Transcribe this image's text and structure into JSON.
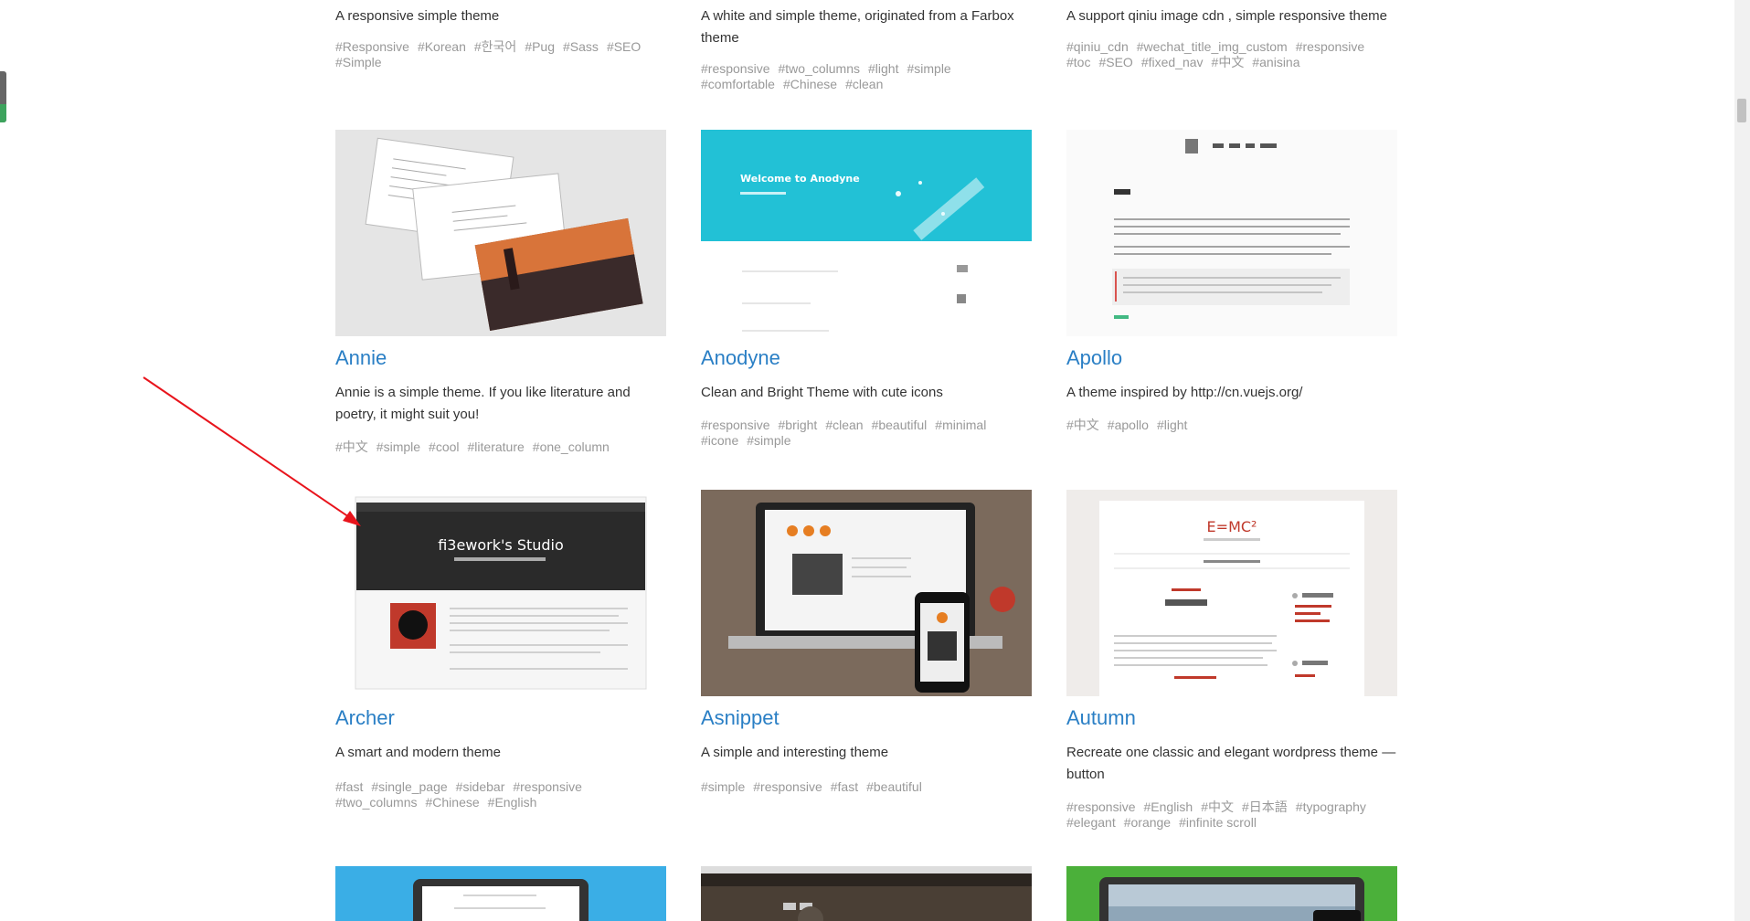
{
  "top_row": [
    {
      "desc": "A responsive simple theme",
      "tags": [
        "#Responsive",
        "#Korean",
        "#한국어",
        "#Pug",
        "#Sass",
        "#SEO",
        "#Simple"
      ]
    },
    {
      "desc": "A white and simple theme, originated from a Farbox theme",
      "tags": [
        "#responsive",
        "#two_columns",
        "#light",
        "#simple",
        "#comfortable",
        "#Chinese",
        "#clean"
      ]
    },
    {
      "desc": "A support qiniu image cdn , simple responsive theme",
      "tags": [
        "#qiniu_cdn",
        "#wechat_title_img_custom",
        "#responsive",
        "#toc",
        "#SEO",
        "#fixed_nav",
        "#中文",
        "#anisina"
      ]
    }
  ],
  "row2": [
    {
      "title": "Annie",
      "desc": "Annie is a simple theme. If you like literature and poetry, it might suit you!",
      "tags": [
        "#中文",
        "#simple",
        "#cool",
        "#literature",
        "#one_column"
      ]
    },
    {
      "title": "Anodyne",
      "desc": "Clean and Bright Theme with cute icons",
      "tags": [
        "#responsive",
        "#bright",
        "#clean",
        "#beautiful",
        "#minimal",
        "#icone",
        "#simple"
      ],
      "thumb_text": "Welcome to Anodyne"
    },
    {
      "title": "Apollo",
      "desc": "A theme inspired by http://cn.vuejs.org/",
      "tags": [
        "#中文",
        "#apollo",
        "#light"
      ]
    }
  ],
  "row3": [
    {
      "title": "Archer",
      "desc": "A smart and modern theme",
      "tags": [
        "#fast",
        "#single_page",
        "#sidebar",
        "#responsive",
        "#two_columns",
        "#Chinese",
        "#English"
      ],
      "thumb_text": "fi3ework's Studio"
    },
    {
      "title": "Asnippet",
      "desc": "A simple and interesting theme",
      "tags": [
        "#simple",
        "#responsive",
        "#fast",
        "#beautiful"
      ]
    },
    {
      "title": "Autumn",
      "desc": "Recreate one classic and elegant wordpress theme — button",
      "tags": [
        "#responsive",
        "#English",
        "#中文",
        "#日本語",
        "#typography",
        "#elegant",
        "#orange",
        "#infinite scroll"
      ],
      "thumb_text": "E=MC²"
    }
  ],
  "colors": {
    "link": "#2a7fc5",
    "tag": "#999999",
    "annotation_arrow": "#e8141c"
  }
}
